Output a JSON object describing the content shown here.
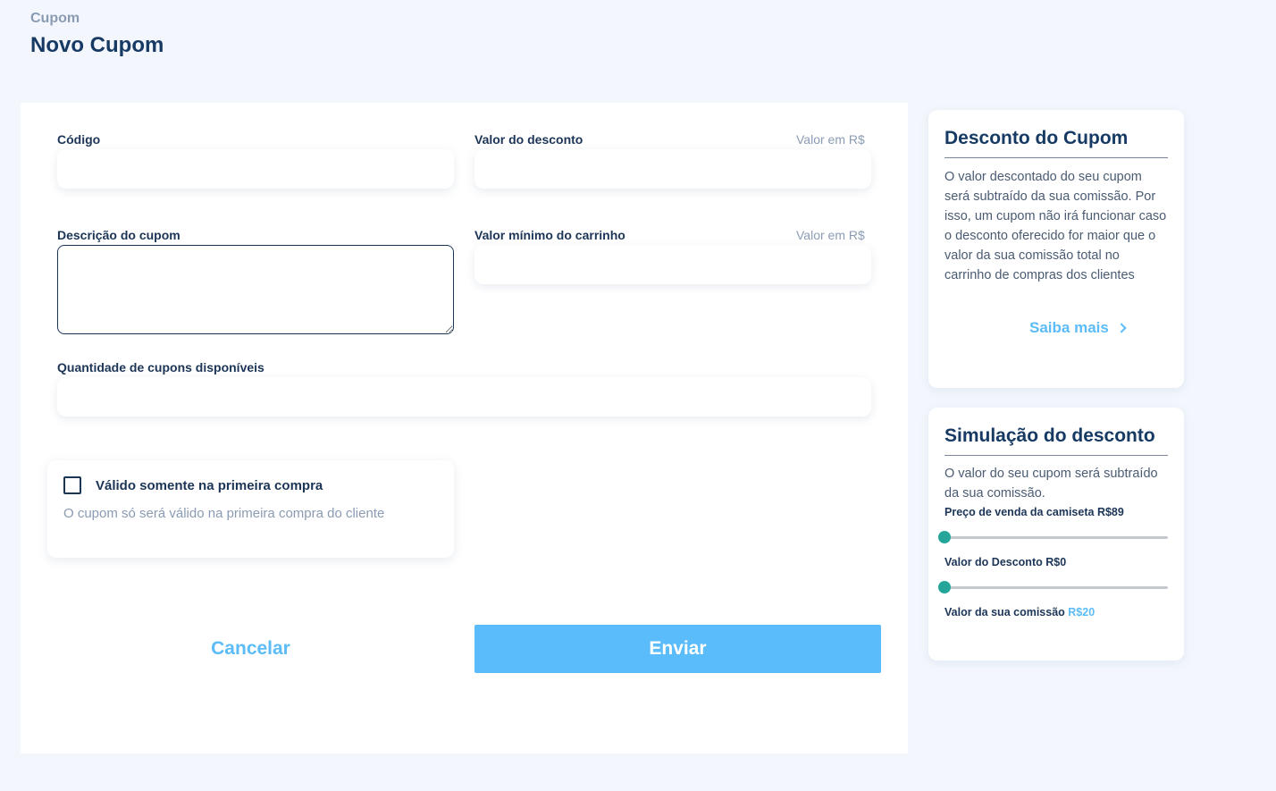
{
  "header": {
    "breadcrumb": "Cupom",
    "title": "Novo Cupom"
  },
  "form": {
    "code": {
      "label": "Código",
      "value": ""
    },
    "discount_value": {
      "label": "Valor do desconto",
      "hint": "Valor em R$",
      "value": ""
    },
    "description": {
      "label": "Descrição do cupom",
      "value": ""
    },
    "min_cart_value": {
      "label": "Valor mínimo do carrinho",
      "hint": "Valor em R$",
      "value": ""
    },
    "quantity": {
      "label": "Quantidade de cupons disponíveis",
      "value": ""
    },
    "first_purchase": {
      "label": "Válido somente na primeira compra",
      "description": "O cupom só será válido na primeira compra do cliente",
      "checked": false
    },
    "cancel_label": "Cancelar",
    "submit_label": "Enviar"
  },
  "info_card": {
    "title": "Desconto do Cupom",
    "text": "O valor descontado do seu cupom será subtraído da sua comissão. Por isso, um cupom não irá funcionar caso o desconto oferecido for maior que o valor da sua comissão total no carrinho de compras dos clientes",
    "link_label": "Saiba mais"
  },
  "simulation_card": {
    "title": "Simulação do desconto",
    "text": "O valor do seu cupom será subtraído da sua comissão.",
    "price_label": "Preço de venda da camiseta",
    "price_value": "R$89",
    "price_slider_level": 0,
    "discount_label": "Valor do Desconto",
    "discount_value": "R$0",
    "discount_slider_level": 0,
    "commission_label": "Valor da sua comissão",
    "commission_value": "R$20"
  },
  "colors": {
    "accent": "#5bbcfb",
    "title": "#163a63",
    "muted": "#8a9bb3",
    "slider_thumb": "#26a69a",
    "background": "#f3f7fd"
  }
}
